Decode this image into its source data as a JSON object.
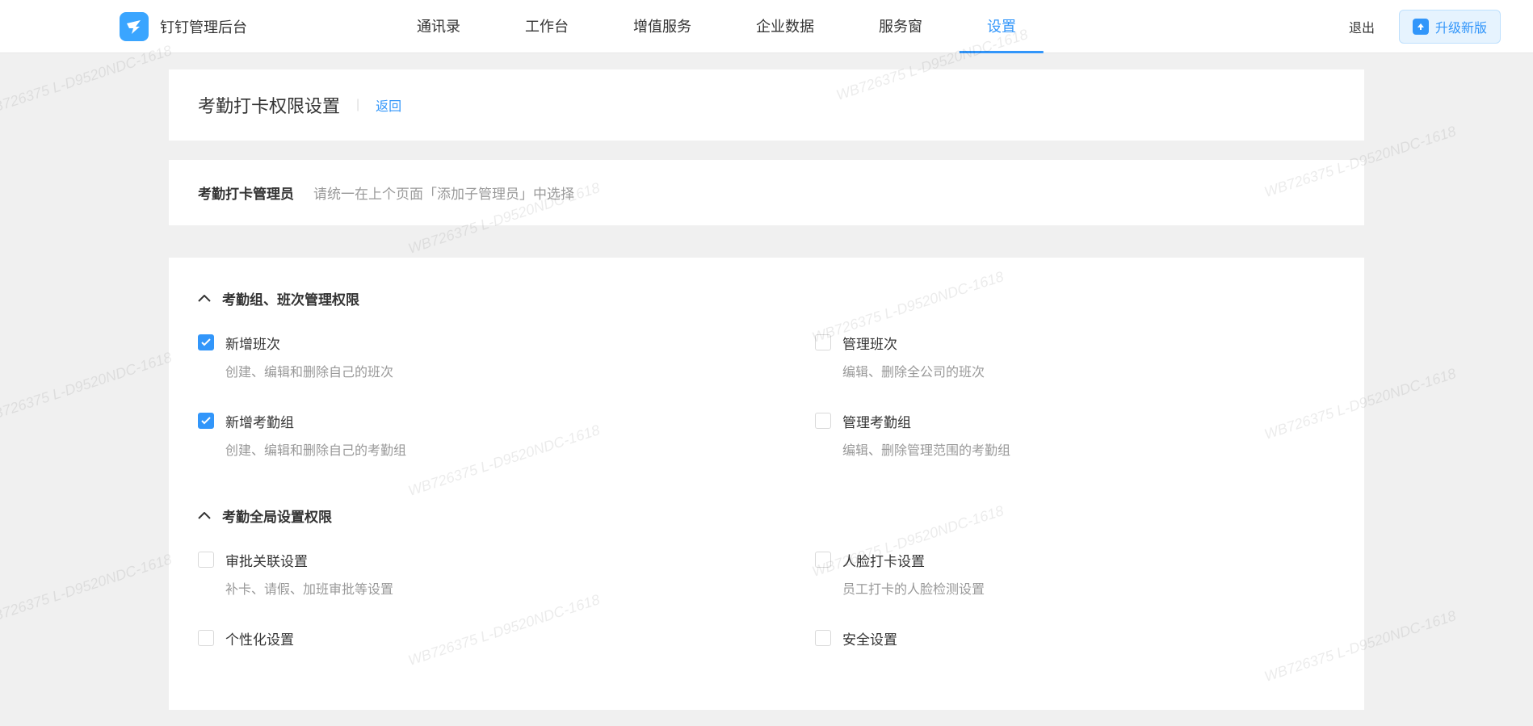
{
  "watermark_text": "WB726375 L-D9520NDC-1618",
  "header": {
    "app_title": "钉钉管理后台",
    "nav": [
      {
        "label": "通讯录",
        "active": false
      },
      {
        "label": "工作台",
        "active": false
      },
      {
        "label": "增值服务",
        "active": false
      },
      {
        "label": "企业数据",
        "active": false
      },
      {
        "label": "服务窗",
        "active": false
      },
      {
        "label": "设置",
        "active": true
      }
    ],
    "logout": "退出",
    "upgrade": "升级新版"
  },
  "page": {
    "title": "考勤打卡权限设置",
    "back": "返回"
  },
  "admin_info": {
    "title": "考勤打卡管理员",
    "desc": "请统一在上个页面「添加子管理员」中选择"
  },
  "sections": [
    {
      "title": "考勤组、班次管理权限",
      "items": [
        {
          "label": "新增班次",
          "desc": "创建、编辑和删除自己的班次",
          "checked": true
        },
        {
          "label": "管理班次",
          "desc": "编辑、删除全公司的班次",
          "checked": false
        },
        {
          "label": "新增考勤组",
          "desc": "创建、编辑和删除自己的考勤组",
          "checked": true
        },
        {
          "label": "管理考勤组",
          "desc": "编辑、删除管理范围的考勤组",
          "checked": false
        }
      ]
    },
    {
      "title": "考勤全局设置权限",
      "items": [
        {
          "label": "审批关联设置",
          "desc": "补卡、请假、加班审批等设置",
          "checked": false
        },
        {
          "label": "人脸打卡设置",
          "desc": "员工打卡的人脸检测设置",
          "checked": false
        },
        {
          "label": "个性化设置",
          "desc": "",
          "checked": false
        },
        {
          "label": "安全设置",
          "desc": "",
          "checked": false
        }
      ]
    }
  ]
}
